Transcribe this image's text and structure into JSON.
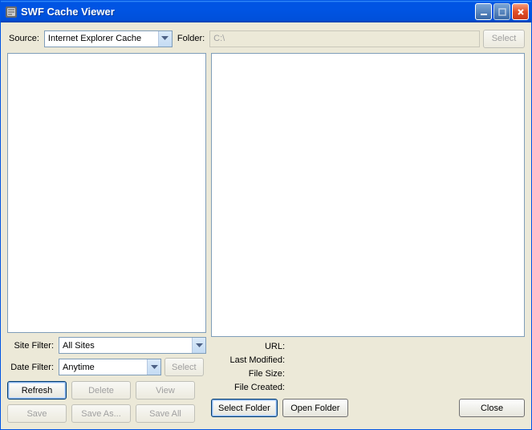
{
  "window": {
    "title": "SWF Cache Viewer"
  },
  "top": {
    "source_label": "Source:",
    "source_value": "Internet Explorer Cache",
    "folder_label": "Folder:",
    "folder_value": "C:\\",
    "select_btn": "Select"
  },
  "filters": {
    "site_label": "Site Filter:",
    "site_value": "All Sites",
    "date_label": "Date Filter:",
    "date_value": "Anytime",
    "date_select_btn": "Select"
  },
  "info": {
    "url_label": "URL:",
    "url_value": "",
    "modified_label": "Last Modified:",
    "modified_value": "",
    "size_label": "File Size:",
    "size_value": "",
    "created_label": "File Created:",
    "created_value": ""
  },
  "buttons": {
    "refresh": "Refresh",
    "delete": "Delete",
    "view": "View",
    "save": "Save",
    "save_as": "Save As...",
    "save_all": "Save All",
    "select_folder": "Select Folder",
    "open_folder": "Open Folder",
    "close": "Close"
  }
}
